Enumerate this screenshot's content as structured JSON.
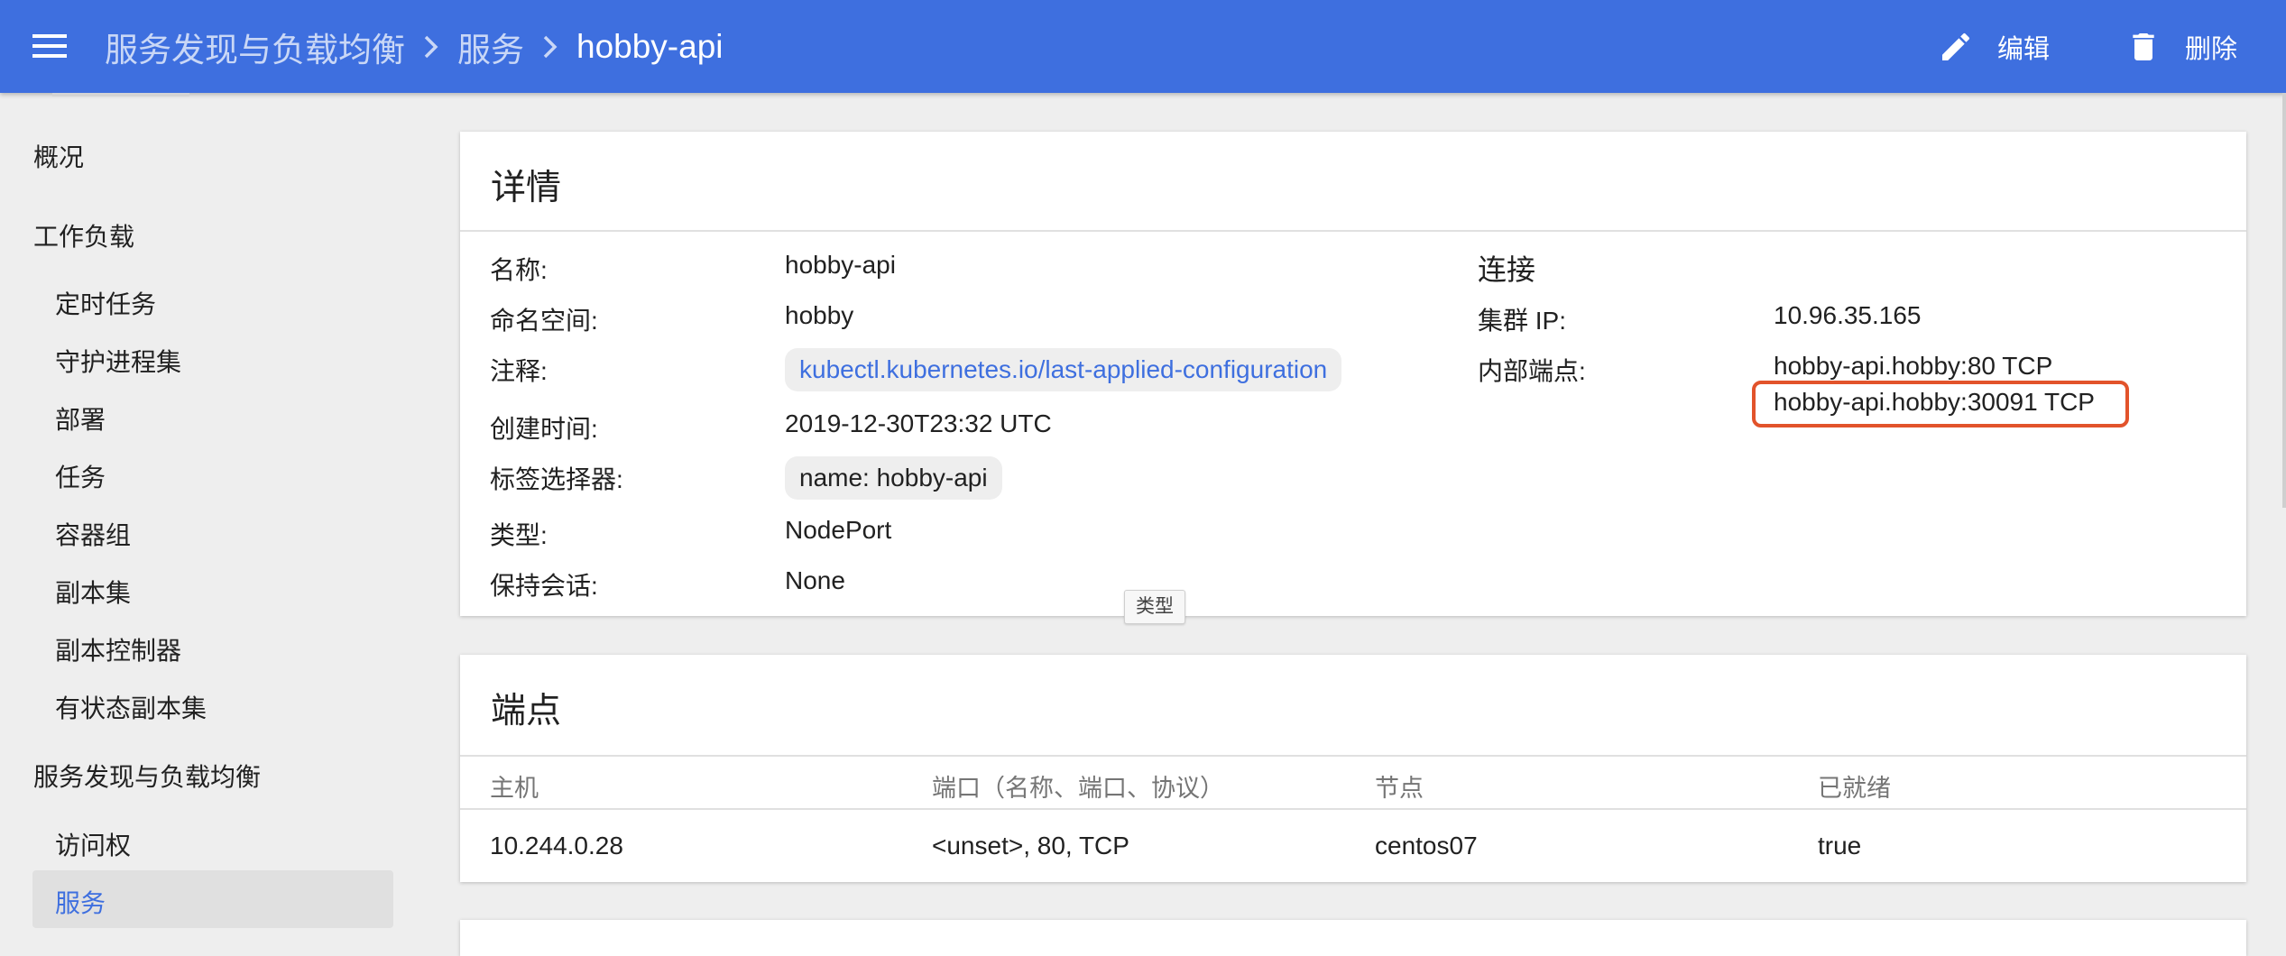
{
  "header": {
    "breadcrumbs": [
      "服务发现与负载均衡",
      "服务"
    ],
    "current": "hobby-api",
    "edit_label": "编辑",
    "delete_label": "删除"
  },
  "sidebar": {
    "overview": "概况",
    "workloads": "工作负载",
    "workload_items": [
      "定时任务",
      "守护进程集",
      "部署",
      "任务",
      "容器组",
      "副本集",
      "副本控制器",
      "有状态副本集"
    ],
    "discovery": "服务发现与负载均衡",
    "discovery_items": [
      "访问权",
      "服务"
    ]
  },
  "details": {
    "title": "详情",
    "name_label": "名称:",
    "name": "hobby-api",
    "namespace_label": "命名空间:",
    "namespace": "hobby",
    "annotations_label": "注释:",
    "annotation": "kubectl.kubernetes.io/last-applied-configuration",
    "created_label": "创建时间:",
    "created": "2019-12-30T23:32 UTC",
    "selector_label": "标签选择器:",
    "selector": "name: hobby-api",
    "type_label": "类型:",
    "type": "NodePort",
    "session_label": "保持会话:",
    "session": "None",
    "tooltip": "类型"
  },
  "connection": {
    "title": "连接",
    "cluster_ip_label": "集群 IP:",
    "cluster_ip": "10.96.35.165",
    "internal_endpoints_label": "内部端点:",
    "internal_endpoints": [
      "hobby-api.hobby:80 TCP",
      "hobby-api.hobby:30091 TCP"
    ]
  },
  "endpoints": {
    "title": "端点",
    "columns": [
      "主机",
      "端口（名称、端口、协议）",
      "节点",
      "已就绪"
    ],
    "rows": [
      [
        "10.244.0.28",
        "<unset>, 80, TCP",
        "centos07",
        "true"
      ]
    ]
  },
  "colors": {
    "primary": "#3e6fdf",
    "highlight": "#e2532b"
  }
}
